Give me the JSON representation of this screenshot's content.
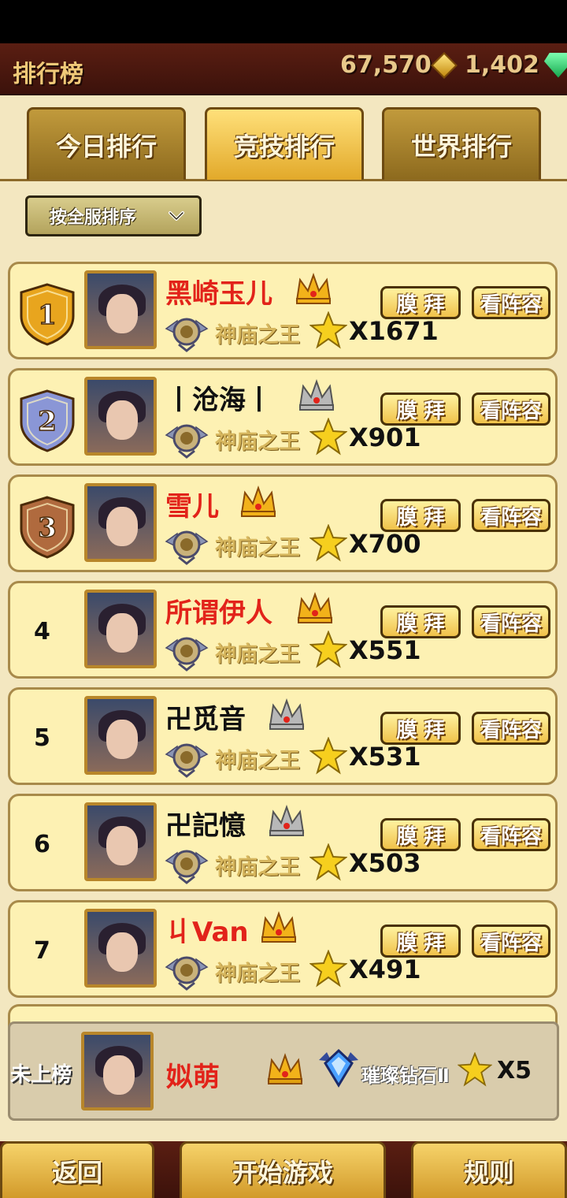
{
  "header": {
    "title": "排行榜",
    "gold": "67,570",
    "gems": "1,402"
  },
  "tabs": [
    {
      "label": "今日排行",
      "active": false
    },
    {
      "label": "竞技排行",
      "active": true
    },
    {
      "label": "世界排行",
      "active": false
    }
  ],
  "filter": {
    "selected": "按全服排序"
  },
  "buttons": {
    "worship": "膜 拜",
    "lineup": "看阵容"
  },
  "rows": [
    {
      "rank": "1",
      "name": "黑崎玉儿",
      "name_color": "#e2231a",
      "crown": "gold",
      "tier": "神庙之王",
      "score": "X1671"
    },
    {
      "rank": "2",
      "name": "丨沧海丨",
      "name_color": "#111111",
      "crown": "silver",
      "tier": "神庙之王",
      "score": "X901"
    },
    {
      "rank": "3",
      "name": "雪儿",
      "name_color": "#e2231a",
      "crown": "gold",
      "tier": "神庙之王",
      "score": "X700"
    },
    {
      "rank": "4",
      "name": "所谓伊人",
      "name_color": "#e2231a",
      "crown": "gold",
      "tier": "神庙之王",
      "score": "X551"
    },
    {
      "rank": "5",
      "name": "卍觅音",
      "name_color": "#111111",
      "crown": "silver",
      "tier": "神庙之王",
      "score": "X531"
    },
    {
      "rank": "6",
      "name": "卍記憶",
      "name_color": "#111111",
      "crown": "silver",
      "tier": "神庙之王",
      "score": "X503"
    },
    {
      "rank": "7",
      "name": "丩Van",
      "name_color": "#e2231a",
      "crown": "gold",
      "tier": "神庙之王",
      "score": "X491"
    }
  ],
  "self": {
    "label": "未上榜",
    "name": "姒萌",
    "tier": "璀璨钻石Ⅱ",
    "score": "X5"
  },
  "bottom": {
    "back": "返回",
    "start": "开始游戏",
    "rules": "规则"
  },
  "colors": {
    "gold_crown": "#f2b21a",
    "silver_crown": "#b8b8b8",
    "rank1": "#e8a51e",
    "rank2": "#8a96d6",
    "rank3": "#b06a3e"
  }
}
